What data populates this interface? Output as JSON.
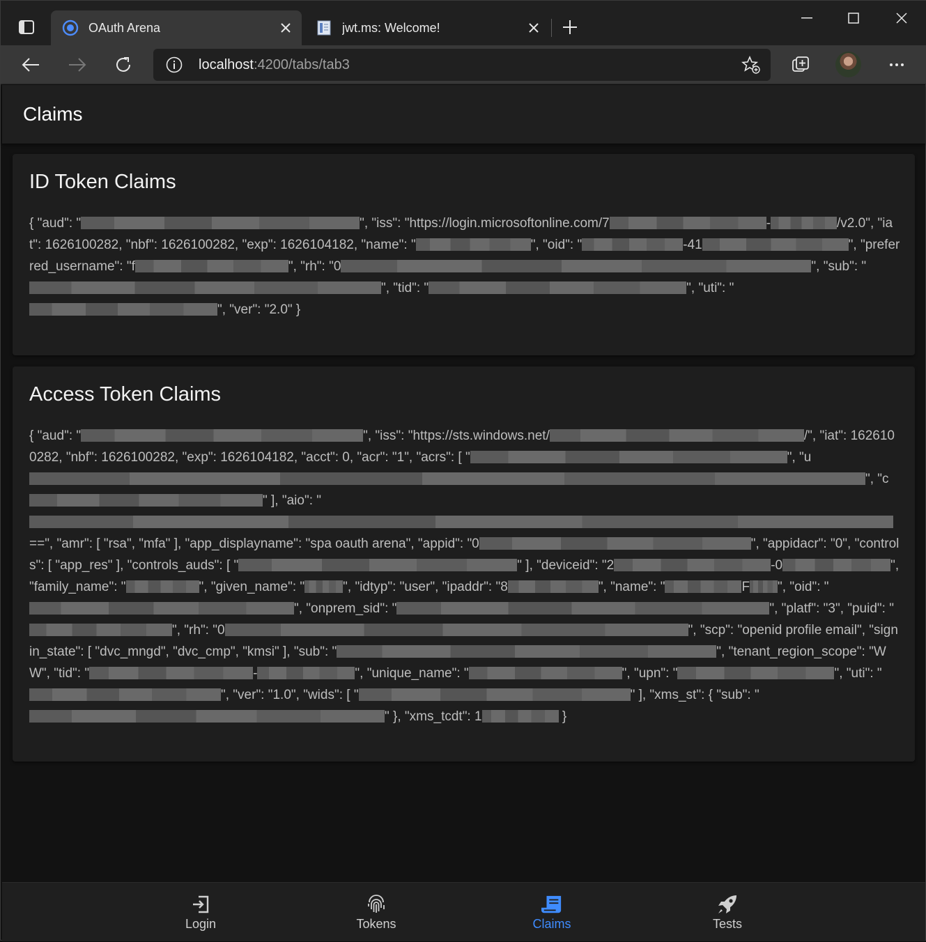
{
  "browser": {
    "tabs": [
      {
        "title": "OAuth Arena",
        "active": true,
        "favicon": "ionic-favicon-icon"
      },
      {
        "title": "jwt.ms: Welcome!",
        "active": false,
        "favicon": "document-favicon-icon"
      }
    ],
    "address": {
      "host": "localhost",
      "path": ":4200/tabs/tab3"
    },
    "colors": {
      "accent": "#3f8cff",
      "frame": "#202020",
      "toolbar": "#383838"
    }
  },
  "page": {
    "title": "Claims",
    "id_card": {
      "title": "ID Token Claims",
      "segments": [
        "{ \"aud\": \"",
        "R400",
        "\", \"iss\": \"https://login.microsoftonline.com/7",
        "R225",
        "-",
        "R95",
        "/v2.0\", \"iat\": 1626100282, \"nbf\": 1626100282, \"exp\": 1626104182, \"name\": \"",
        "R165",
        "\", \"oid\": \"",
        "R145",
        "-41",
        "R210",
        "\", \"preferred_username\": \"f",
        "R220",
        "\", \"rh\": \"0",
        "R675",
        "\", \"sub\": \"",
        "R505",
        "\", \"tid\": \"",
        "R370",
        "\", \"uti\": \"",
        "R270",
        "\", \"ver\": \"2.0\" }"
      ]
    },
    "access_card": {
      "title": "Access Token Claims",
      "segments": [
        "{ \"aud\": \"",
        "R405",
        "\", \"iss\": \"https://sts.windows.net/",
        "R365",
        "/\", \"iat\": 1626100282, \"nbf\": 1626100282, \"exp\": 1626104182, \"acct\": 0, \"acr\": \"1\", \"acrs\": [ \"",
        "R455",
        "\", \"u",
        "R1200",
        "\", \"c",
        "R335",
        "\" ], \"aio\": \"",
        "R1240",
        "==\", \"amr\": [ \"rsa\", \"mfa\" ], \"app_displayname\": \"spa oauth arena\", \"appid\": \"0",
        "R390",
        "\", \"appidacr\": \"0\", \"controls\": [ \"app_res\" ], \"controls_auds\": [ \"",
        "R400",
        "\" ], \"deviceid\": \"2",
        "R225",
        "-0",
        "R155",
        "\", \"family_name\": \"",
        "R105",
        "\", \"given_name\": \"",
        "R55",
        "\", \"idtyp\": \"user\", \"ipaddr\": \"8",
        "R130",
        "\", \"name\": \"",
        "R110",
        "F",
        "R40",
        "\", \"oid\": \"",
        "R380",
        "\", \"onprem_sid\": \"",
        "R535",
        "\", \"platf\": \"3\", \"puid\": \"",
        "R205",
        "\", \"rh\": \"0",
        "R665",
        "\", \"scp\": \"openid profile email\", \"signin_state\": [ \"dvc_mngd\", \"dvc_cmp\", \"kmsi\" ], \"sub\": \"",
        "R545",
        "\", \"tenant_region_scope\": \"WW\", \"tid\": \"",
        "R235",
        "-",
        "R140",
        "\", \"unique_name\": \"",
        "R220",
        "\", \"upn\": \"",
        "R225",
        "\", \"uti\": \"",
        "R275",
        "\", \"ver\": \"1.0\", \"wids\": [ \"",
        "R390",
        "\" ], \"xms_st\": { \"sub\": \"",
        "R510",
        "\" }, \"xms_tcdt\": 1",
        "R110",
        " }"
      ]
    }
  },
  "tabbar": {
    "items": [
      {
        "label": "Login",
        "icon": "login-icon",
        "selected": false
      },
      {
        "label": "Tokens",
        "icon": "fingerprint-icon",
        "selected": false
      },
      {
        "label": "Claims",
        "icon": "receipt-icon",
        "selected": true
      },
      {
        "label": "Tests",
        "icon": "rocket-icon",
        "selected": false
      }
    ]
  }
}
